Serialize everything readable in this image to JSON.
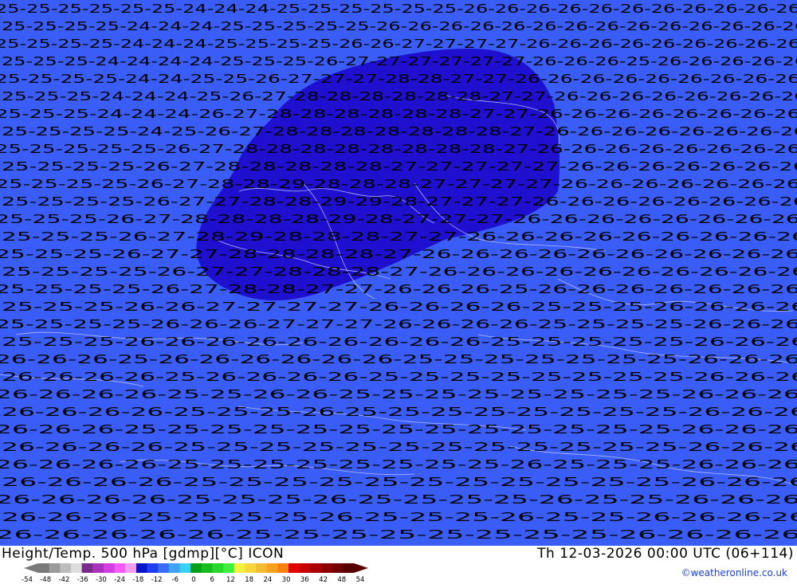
{
  "map": {
    "background_color": "#3a5df8",
    "warm_core_color": "#1f0fcf",
    "border_color": "#b9c4ff",
    "contour_rows": [
      "25-25-25-25-25-25-24-24-24-25-25-25-25-25-25-26-26-26-26-26-26-26-26-26-26-26",
      "25-25-25-25-24-24-24-25-25-25-25-25-26-26-26-26-26-26-26-26-26-26-26-26-26-26",
      "25-25-25-25-24-24-24-25-25-25-25-26-26-27-27-27-27-26-26-26-26-26-26-26-26-26",
      "25-25-25-24-24-24-24-25-25-25-26-27-27-27-27-27-27-26-26-26-25-26-26-26-26-26",
      "25-25-25-25-24-24-25-25-26-27-27-27-28-28-27-27-26-26-26-26-26-26-26-26-26",
      "25-25-25-24-24-24-25-26-27-28-28-28-28-28-28-27-27-26-26-26-26-26-26-26-26",
      "25-25-25-24-24-24-26-27-28-28-28-28-28-28-27-27-26-26-26-26-26-26-26-26",
      "25-25-25-25-24-25-26-27-28-28-28-28-28-28-28-27-26-26-26-26-26-26-26-26",
      "25-25-25-25-25-26-27-28-28-28-28-28-28-28-28-27-26-26-26-26-26-26-26-26",
      "25-25-25-25-26-27-28-28-28-28-28-27-27-27-27-27-26-26-26-26-26-26-26",
      "25-25-25-25-26-27-28-28-29-28-28-28-27-27-27-27-26-26-26-26-26-26-26",
      "25-25-25-25-26-27-27-28-28-29-29-28-27-27-27-26-26-26-26-26-26-26-26",
      "25-25-25-26-27-28-28-28-28-29-28-27-27-27-26-26-26-26-26-26-26-26",
      "25-25-25-26-27-28-29-28-28-28-27-27-26-26-26-26-26-26-26-26-26",
      "25-25-25-26-27-27-28-28-28-28-27-26-26-26-26-26-26-26-26-26-26",
      "25-25-25-25-26-27-27-28-28-28-27-26-26-26-26-26-26-26-26-26-26",
      "25-25-25-25-26-27-28-28-27-27-26-26-26-25-26-26-26-26-26-26-26",
      "25-25-25-26-26-27-27-27-27-26-26-26-26-25-25-25-26-26-26-26",
      "25-25-25-25-26-26-26-27-27-27-26-26-26-26-25-25-25-25-26-26-26",
      "25-25-25-26-26-26-26-26-26-26-26-26-25-25-25-25-25-26-26-26",
      "26-26-26-25-26-26-26-26-26-26-25-25-25-25-25-25-25-26-26-26",
      "26-26-26-26-25-26-26-26-26-25-25-25-25-25-25-25-25-26-26-26",
      "26-26-26-26-25-25-26-26-25-25-25-25-25-25-25-25-26-26-26",
      "26-26-26-26-25-25-25-26-25-25-25-25-25-25-25-25-26-26-26",
      "26-26-26-25-25-25-25-25-25-25-25-25-25-25-25-25-26-26-26",
      "26-26-26-26-25-25-25-25-25-25-25-25-25-25-25-25-26-26-26",
      "26-26-26-26-25-25-25-25-25-25-25-25-26-25-25-25-26-26-26",
      "26-26-26-26-25-25-25-25-25-25-25-25-25-25-25-26-26-26",
      "26-26-26-26-25-25-25-26-25-25-25-25-26-25-25-26-26-26",
      "26-26-26-25-25-25-25-26-25-25-25-26-25-25-26-26-26-26",
      "26-26-26-26-26-25-25-25-25-25-25-25-25-26-26-26-26"
    ]
  },
  "footer": {
    "title": "Height/Temp. 500 hPa [gdmp][°C] ICON",
    "datetime": "Th 12-03-2026 00:00 UTC (06+114)",
    "credit": "©weatheronline.co.uk",
    "legend": {
      "ticks": [
        "-54",
        "-48",
        "-42",
        "-36",
        "-30",
        "-24",
        "-18",
        "-12",
        "-6",
        "0",
        "6",
        "12",
        "18",
        "24",
        "30",
        "36",
        "42",
        "48",
        "54"
      ],
      "colors": [
        "#7a7a7a",
        "#9a9a9a",
        "#bdbdbd",
        "#dcdcdc",
        "#7a2a8c",
        "#a832b8",
        "#d23ee0",
        "#f25cf2",
        "#f79ef2",
        "#0a14c8",
        "#1f3cf0",
        "#3a6cf8",
        "#3fa2f5",
        "#38d2f2",
        "#08a018",
        "#18bc18",
        "#28d628",
        "#3cf03c",
        "#f2f23c",
        "#f5d73c",
        "#f5bb30",
        "#f5a020",
        "#f58010",
        "#e00000",
        "#c40000",
        "#a80000",
        "#8c0000",
        "#700000",
        "#580000"
      ]
    }
  }
}
